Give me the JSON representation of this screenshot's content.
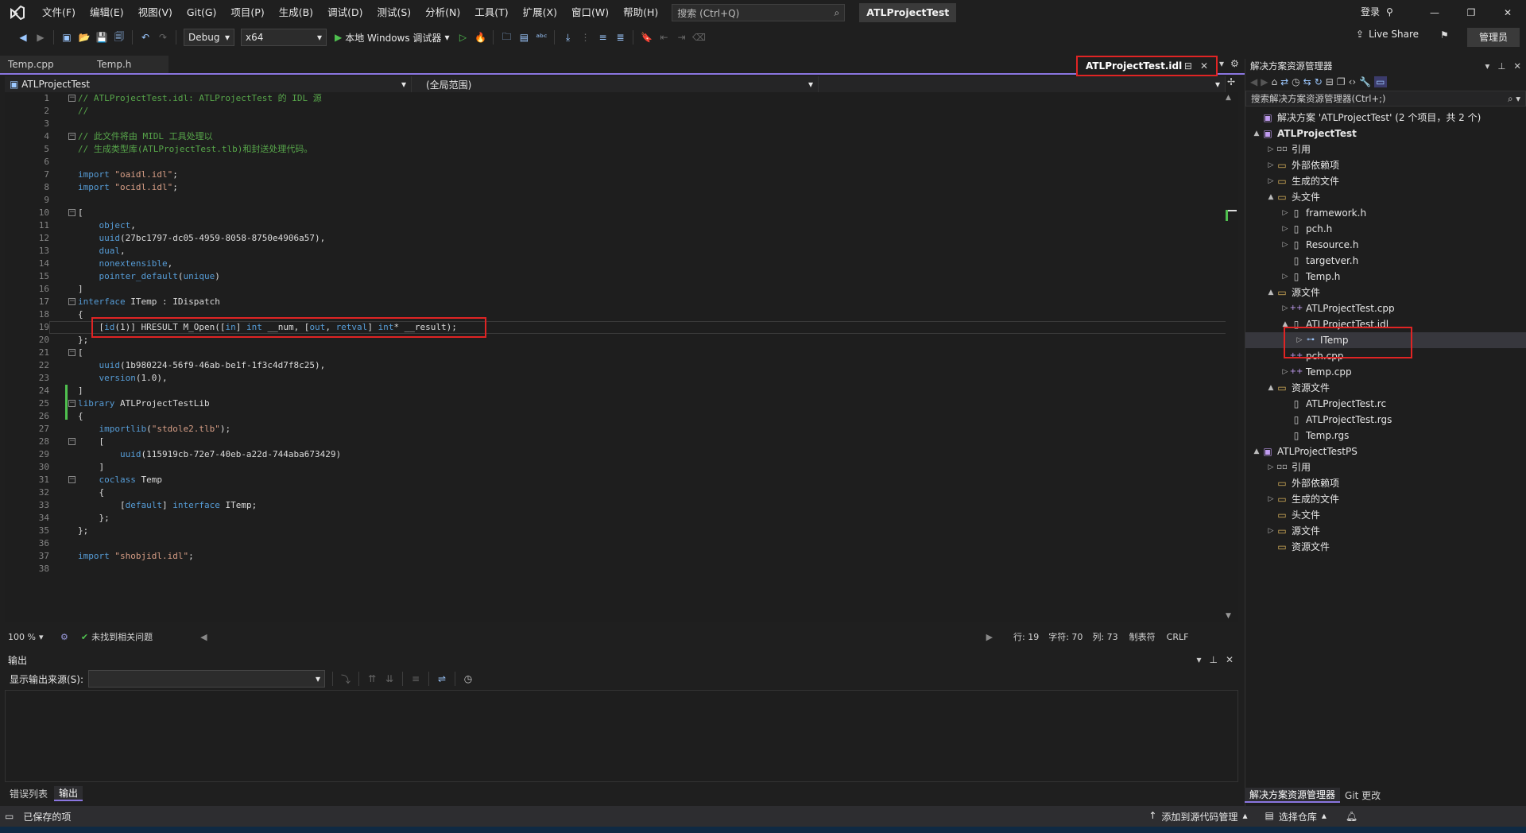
{
  "menu": [
    "文件(F)",
    "编辑(E)",
    "视图(V)",
    "Git(G)",
    "项目(P)",
    "生成(B)",
    "调试(D)",
    "测试(S)",
    "分析(N)",
    "工具(T)",
    "扩展(X)",
    "窗口(W)",
    "帮助(H)"
  ],
  "search_placeholder": "搜索 (Ctrl+Q)",
  "solution_title": "ATLProjectTest",
  "login_label": "登录",
  "toolbar": {
    "config": "Debug",
    "platform": "x64",
    "run_label": "本地 Windows 调试器",
    "live_share": "Live Share",
    "admin": "管理员"
  },
  "tabs": {
    "tab1": "Temp.cpp",
    "tab2": "Temp.h",
    "active": "ATLProjectTest.idl"
  },
  "navbar": {
    "project": "ATLProjectTest",
    "scope": "(全局范围)"
  },
  "code_lines": [
    "// ATLProjectTest.idl: ATLProjectTest 的 IDL 源",
    "//",
    "",
    "// 此文件将由 MIDL 工具处理以",
    "// 生成类型库(ATLProjectTest.tlb)和封送处理代码。",
    "",
    "import \"oaidl.idl\";",
    "import \"ocidl.idl\";",
    "",
    "[",
    "    object,",
    "    uuid(27bc1797-dc05-4959-8058-8750e4906a57),",
    "    dual,",
    "    nonextensible,",
    "    pointer_default(unique)",
    "]",
    "interface ITemp : IDispatch",
    "{",
    "    [id(1)] HRESULT M_Open([in] int __num, [out, retval] int* __result);",
    "};",
    "[",
    "    uuid(1b980224-56f9-46ab-be1f-1f3c4d7f8c25),",
    "    version(1.0),",
    "]",
    "library ATLProjectTestLib",
    "{",
    "    importlib(\"stdole2.tlb\");",
    "    [",
    "        uuid(115919cb-72e7-40eb-a22d-744aba673429)",
    "    ]",
    "    coclass Temp",
    "    {",
    "        [default] interface ITemp;",
    "    };",
    "};",
    "",
    "import \"shobjidl.idl\";",
    ""
  ],
  "status": {
    "zoom": "100 %",
    "issues": "未找到相关问题",
    "line": "行: 19",
    "char": "字符: 70",
    "col": "列: 73",
    "tabs": "制表符",
    "eol": "CRLF"
  },
  "output": {
    "title": "输出",
    "source_label": "显示输出来源(S):"
  },
  "bottom_tabs": [
    "错误列表",
    "输出"
  ],
  "statusbar": {
    "saved": "已保存的项",
    "add_source": "添加到源代码管理",
    "select_repo": "选择仓库"
  },
  "solution_explorer": {
    "title": "解决方案资源管理器",
    "search": "搜索解决方案资源管理器(Ctrl+;)",
    "items": [
      {
        "label": "解决方案 'ATLProjectTest' (2 个项目，共 2 个)",
        "depth": 0,
        "arrow": "",
        "icon": "solution"
      },
      {
        "label": "ATLProjectTest",
        "depth": 0,
        "arrow": "▲",
        "icon": "project",
        "bold": true
      },
      {
        "label": "引用",
        "depth": 1,
        "arrow": "▷",
        "icon": "ref"
      },
      {
        "label": "外部依赖项",
        "depth": 1,
        "arrow": "▷",
        "icon": "folder"
      },
      {
        "label": "生成的文件",
        "depth": 1,
        "arrow": "▷",
        "icon": "folder"
      },
      {
        "label": "头文件",
        "depth": 1,
        "arrow": "▲",
        "icon": "folder"
      },
      {
        "label": "framework.h",
        "depth": 2,
        "arrow": "▷",
        "icon": "file"
      },
      {
        "label": "pch.h",
        "depth": 2,
        "arrow": "▷",
        "icon": "file"
      },
      {
        "label": "Resource.h",
        "depth": 2,
        "arrow": "▷",
        "icon": "file"
      },
      {
        "label": "targetver.h",
        "depth": 2,
        "arrow": "",
        "icon": "file"
      },
      {
        "label": "Temp.h",
        "depth": 2,
        "arrow": "▷",
        "icon": "file"
      },
      {
        "label": "源文件",
        "depth": 1,
        "arrow": "▲",
        "icon": "folder"
      },
      {
        "label": "ATLProjectTest.cpp",
        "depth": 2,
        "arrow": "▷",
        "icon": "cpp"
      },
      {
        "label": "ATLProjectTest.idl",
        "depth": 2,
        "arrow": "▲",
        "icon": "file"
      },
      {
        "label": "ITemp",
        "depth": 3,
        "arrow": "▷",
        "icon": "iface"
      },
      {
        "label": "pch.cpp",
        "depth": 2,
        "arrow": "",
        "icon": "cpp"
      },
      {
        "label": "Temp.cpp",
        "depth": 2,
        "arrow": "▷",
        "icon": "cpp"
      },
      {
        "label": "资源文件",
        "depth": 1,
        "arrow": "▲",
        "icon": "folder"
      },
      {
        "label": "ATLProjectTest.rc",
        "depth": 2,
        "arrow": "",
        "icon": "file"
      },
      {
        "label": "ATLProjectTest.rgs",
        "depth": 2,
        "arrow": "",
        "icon": "file"
      },
      {
        "label": "Temp.rgs",
        "depth": 2,
        "arrow": "",
        "icon": "file"
      },
      {
        "label": "ATLProjectTestPS",
        "depth": 0,
        "arrow": "▲",
        "icon": "project"
      },
      {
        "label": "引用",
        "depth": 1,
        "arrow": "▷",
        "icon": "ref"
      },
      {
        "label": "外部依赖项",
        "depth": 1,
        "arrow": "",
        "icon": "folder"
      },
      {
        "label": "生成的文件",
        "depth": 1,
        "arrow": "▷",
        "icon": "folder"
      },
      {
        "label": "头文件",
        "depth": 1,
        "arrow": "",
        "icon": "folder"
      },
      {
        "label": "源文件",
        "depth": 1,
        "arrow": "▷",
        "icon": "folder"
      },
      {
        "label": "资源文件",
        "depth": 1,
        "arrow": "",
        "icon": "folder"
      }
    ],
    "bottom_tabs": [
      "解决方案资源管理器",
      "Git 更改"
    ]
  },
  "colors": {
    "accent": "#8a76e0",
    "highlight": "#e02424"
  }
}
